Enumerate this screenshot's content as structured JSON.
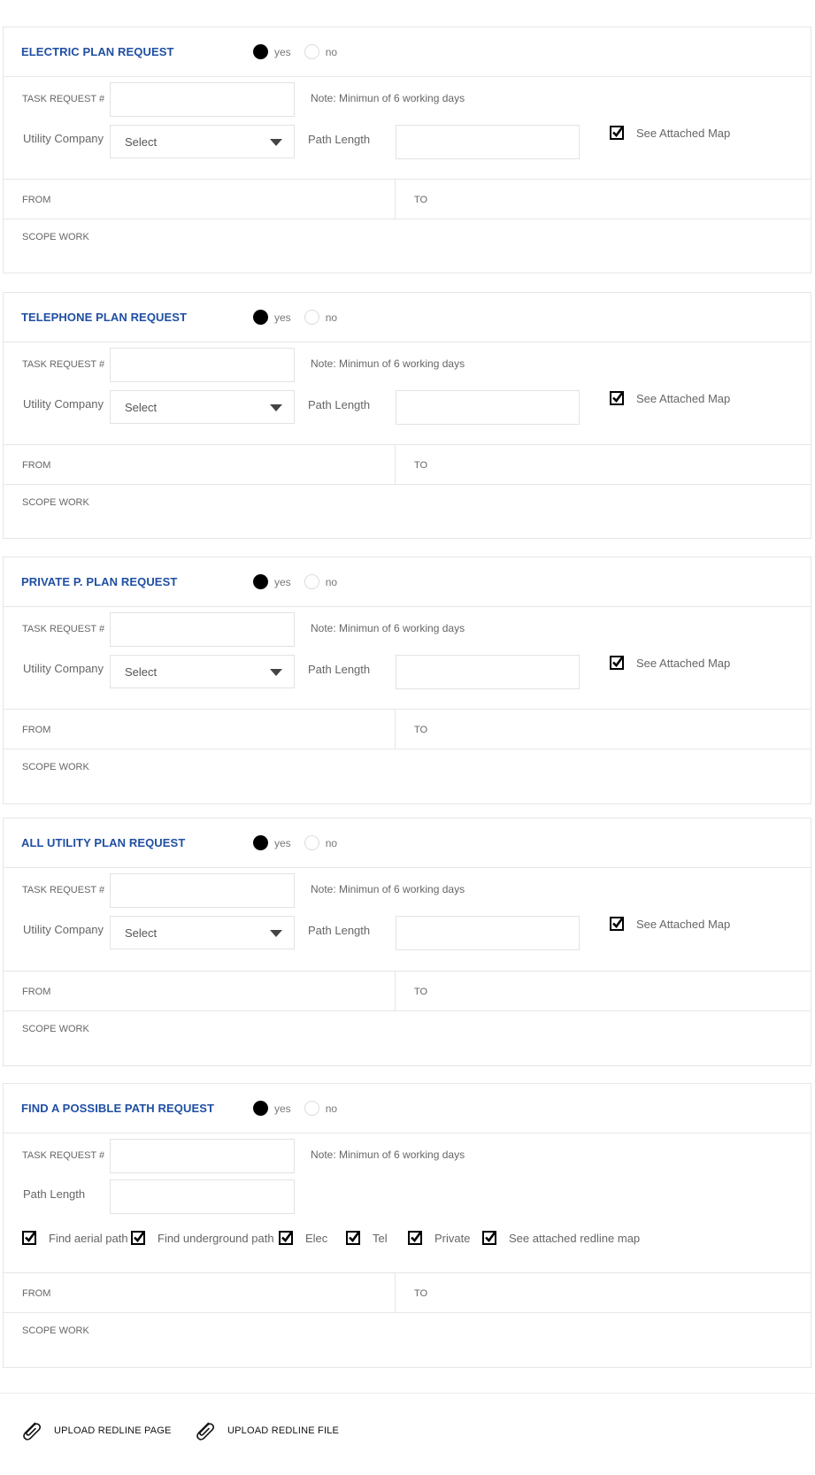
{
  "sections": [
    {
      "title": "ELECTRIC PLAN REQUEST",
      "yes": "yes",
      "no": "no",
      "selected": "yes"
    },
    {
      "title": "TELEPHONE PLAN REQUEST",
      "yes": "yes",
      "no": "no",
      "selected": "yes"
    },
    {
      "title": "PRIVATE P. PLAN REQUEST",
      "yes": "yes",
      "no": "no",
      "selected": "yes"
    },
    {
      "title": "ALL UTILITY PLAN REQUEST",
      "yes": "yes",
      "no": "no",
      "selected": "yes"
    },
    {
      "title": "FIND A POSSIBLE PATH REQUEST",
      "yes": "yes",
      "no": "no",
      "selected": "yes"
    }
  ],
  "labels": {
    "task_request": "TASK REQUEST #",
    "note": "Note: Minimun of 6 working days",
    "utility_company": "Utility Company",
    "select_value": "Select",
    "path_length": "Path Length",
    "see_attached_map": "See Attached Map",
    "from": "FROM",
    "to": "TO",
    "scope_work": "SCOPE WORK"
  },
  "path_options": [
    {
      "label": "Find aerial path",
      "checked": true
    },
    {
      "label": "Find underground path",
      "checked": true
    },
    {
      "label": "Elec",
      "checked": true
    },
    {
      "label": "Tel",
      "checked": true
    },
    {
      "label": "Private",
      "checked": true
    },
    {
      "label": "See attached redline map",
      "checked": true
    }
  ],
  "uploads": {
    "page": "UPLOAD REDLINE PAGE",
    "file": "UPLOAD REDLINE FILE",
    "icon": "paperclip-icon"
  },
  "colors": {
    "title_blue": "#1f4fa3",
    "border": "#e6e6e6"
  }
}
